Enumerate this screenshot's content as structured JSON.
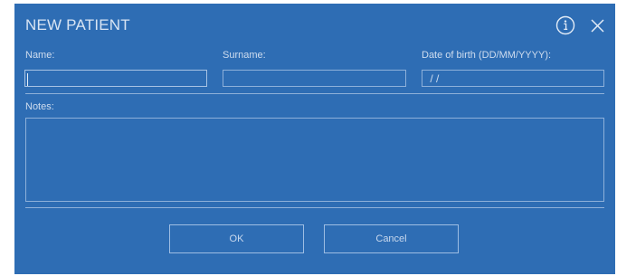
{
  "dialog": {
    "title": "NEW PATIENT",
    "info_icon": "info-circle-icon",
    "close_icon": "close-x-icon"
  },
  "form": {
    "name_label": "Name:",
    "name_value": "",
    "surname_label": "Surname:",
    "surname_value": "",
    "dob_label": "Date of birth (DD/MM/YYYY):",
    "dob_placeholder": " / /",
    "notes_label": "Notes:",
    "notes_value": ""
  },
  "buttons": {
    "ok_label": "OK",
    "cancel_label": "Cancel"
  },
  "colors": {
    "background": "#2e6db4",
    "border": "#8db0da",
    "text": "#cfddef"
  }
}
